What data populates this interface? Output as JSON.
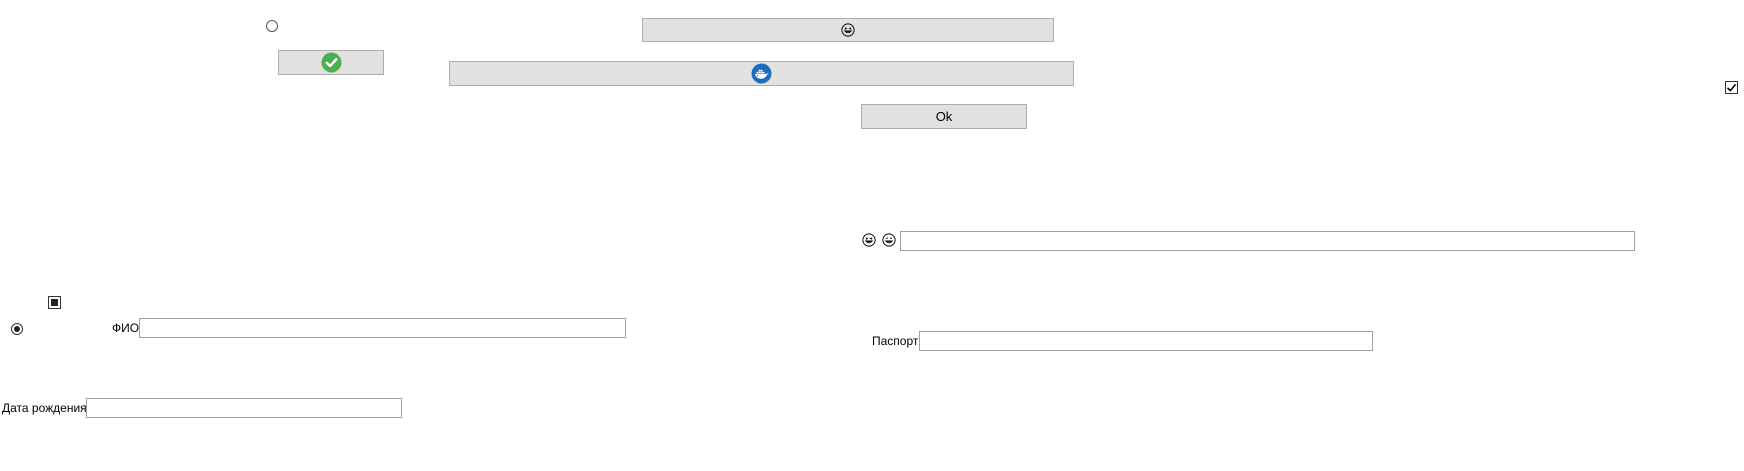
{
  "window": {
    "background": "#ffffff"
  },
  "controls": {
    "emoji_button": {
      "icon": "grinning-squint-face-icon"
    },
    "check_button": {
      "icon": "green-check-circle-icon",
      "color": "#4caf50"
    },
    "docker_button": {
      "icon": "docker-whale-icon",
      "color": "#1f6bc0"
    },
    "ok_button": {
      "label": "Ok"
    },
    "top_radio": {
      "checked": false
    },
    "top_right_checkbox": {
      "checked": true
    },
    "indeterminate_checkbox": {
      "state": "indeterminate"
    },
    "selected_radio": {
      "checked": true
    },
    "emoji_row": {
      "icons": [
        "grinning-squint-face-icon",
        "grinning-face-icon"
      ],
      "value": ""
    }
  },
  "form": {
    "fio": {
      "label": "ФИО",
      "value": ""
    },
    "birth_date": {
      "label": "Дата рождения",
      "value": ""
    },
    "passport": {
      "label": "Паспорт",
      "value": ""
    }
  }
}
